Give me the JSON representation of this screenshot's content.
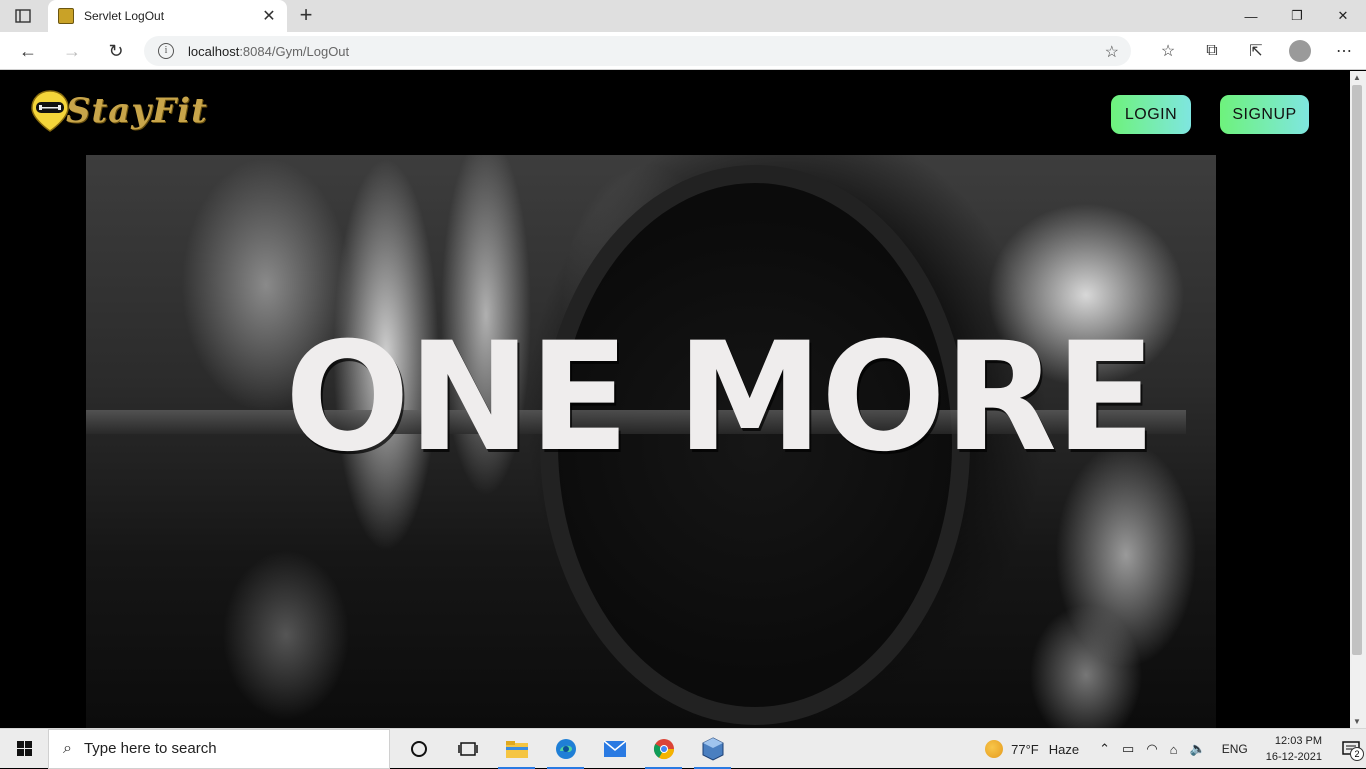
{
  "browser": {
    "tab_title": "Servlet LogOut",
    "url_host": "localhost",
    "url_path": ":8084/Gym/LogOut"
  },
  "site": {
    "logo_text": "StayFit",
    "login_label": "LOGIN",
    "signup_label": "SIGNUP",
    "hero_text": "ONE MORE",
    "accent_gradient": [
      "#6ef27c",
      "#7fe6e0"
    ],
    "logo_color": "#c8a54a"
  },
  "taskbar": {
    "search_placeholder": "Type here to search",
    "weather_temp": "77°F",
    "weather_desc": "Haze",
    "language": "ENG",
    "time": "12:03 PM",
    "date": "16-12-2021",
    "notification_count": "2"
  }
}
